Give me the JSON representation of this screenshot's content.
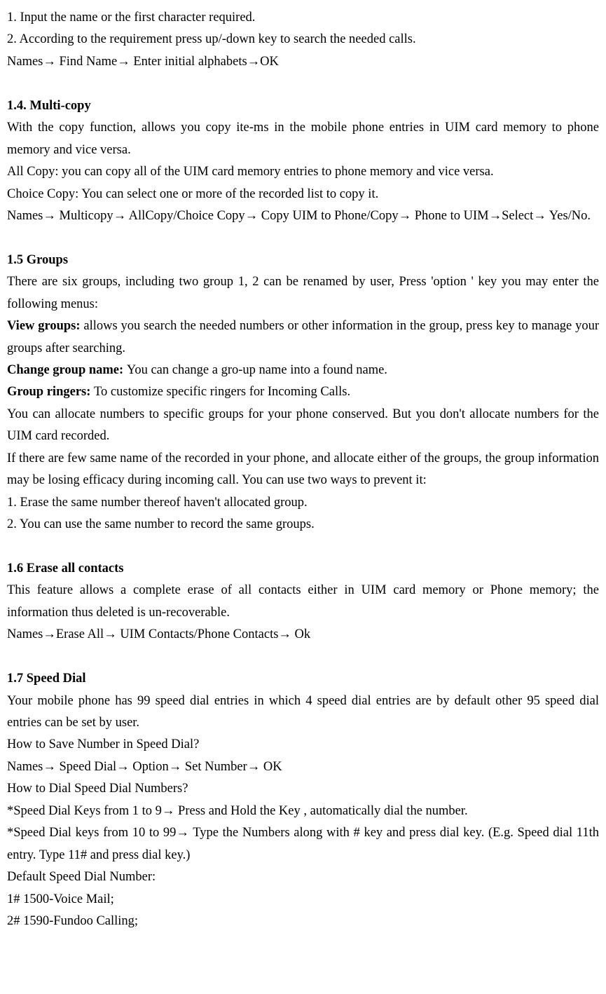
{
  "lines": {
    "l1": "1. Input the name or the first character required.",
    "l2": "2. According to the requirement press up/-down key to search the needed calls.",
    "l3": "Names→  Find Name→  Enter initial alphabets→OK",
    "h14": "1.4. Multi-copy",
    "l14a": "With the copy function, allows you copy ite-ms in the mobile phone entries in UIM card memory to phone memory and vice versa.",
    "l14b": "All Copy: you can copy all of the UIM card memory entries to phone memory and vice versa.",
    "l14c": "Choice Copy: You can select one or more of the recorded list to copy it.",
    "l14d": "Names→  Multicopy→  AllCopy/Choice Copy→  Copy UIM to Phone/Copy→  Phone to UIM→Select→  Yes/No.",
    "h15": "1.5   Groups",
    "l15a": "There are six groups, including two group 1, 2 can be renamed by user, Press 'option ' key you may enter the following menus:",
    "l15b_bold": "View groups: ",
    "l15b_rest": "allows you search the needed numbers or other information in the group, press key to manage your groups after searching.",
    "l15c_bold": "Change group name: ",
    "l15c_rest": "You can change a gro-up name into a found name.",
    "l15d_bold": "Group ringers: ",
    "l15d_rest": "To customize specific ringers for Incoming Calls.",
    "l15e": "You can allocate numbers to specific groups for your phone conserved. But you don't allocate numbers for the UIM card recorded.",
    "l15f": "If there are few same name of the recorded in your phone, and allocate either of the groups, the group information may be losing efficacy during incoming call. You can use two ways to prevent it:",
    "l15g": "1. Erase the same number thereof haven't allocated group.",
    "l15h": "2. You can use the same number to record the same groups.",
    "h16": "1.6 Erase all contacts",
    "l16a": "This feature allows a complete erase of all contacts either in UIM card memory or Phone memory; the information thus deleted is un-recoverable.",
    "l16b": "Names→Erase All→  UIM Contacts/Phone Contacts→  Ok",
    "h17": "1.7 Speed Dial",
    "l17a": "Your mobile phone has 99 speed dial entries in which 4 speed dial entries are by default other 95 speed dial entries can be set by user.",
    "l17b": "How to Save Number in Speed Dial?",
    "l17c": "Names→  Speed Dial→  Option→  Set Number→  OK",
    "l17d": "How to Dial Speed Dial Numbers?",
    "l17e": "*Speed Dial Keys from 1 to 9→  Press and Hold the Key , automatically dial the number.",
    "l17f": "*Speed Dial keys from 10 to 99→  Type    the Numbers along with # key and press dial key. (E.g. Speed dial 11th entry. Type 11# and press dial key.)",
    "l17g": "Default Speed Dial Number:",
    "l17h": "1# 1500-Voice Mail;",
    "l17i": "2# 1590-Fundoo Calling;"
  }
}
